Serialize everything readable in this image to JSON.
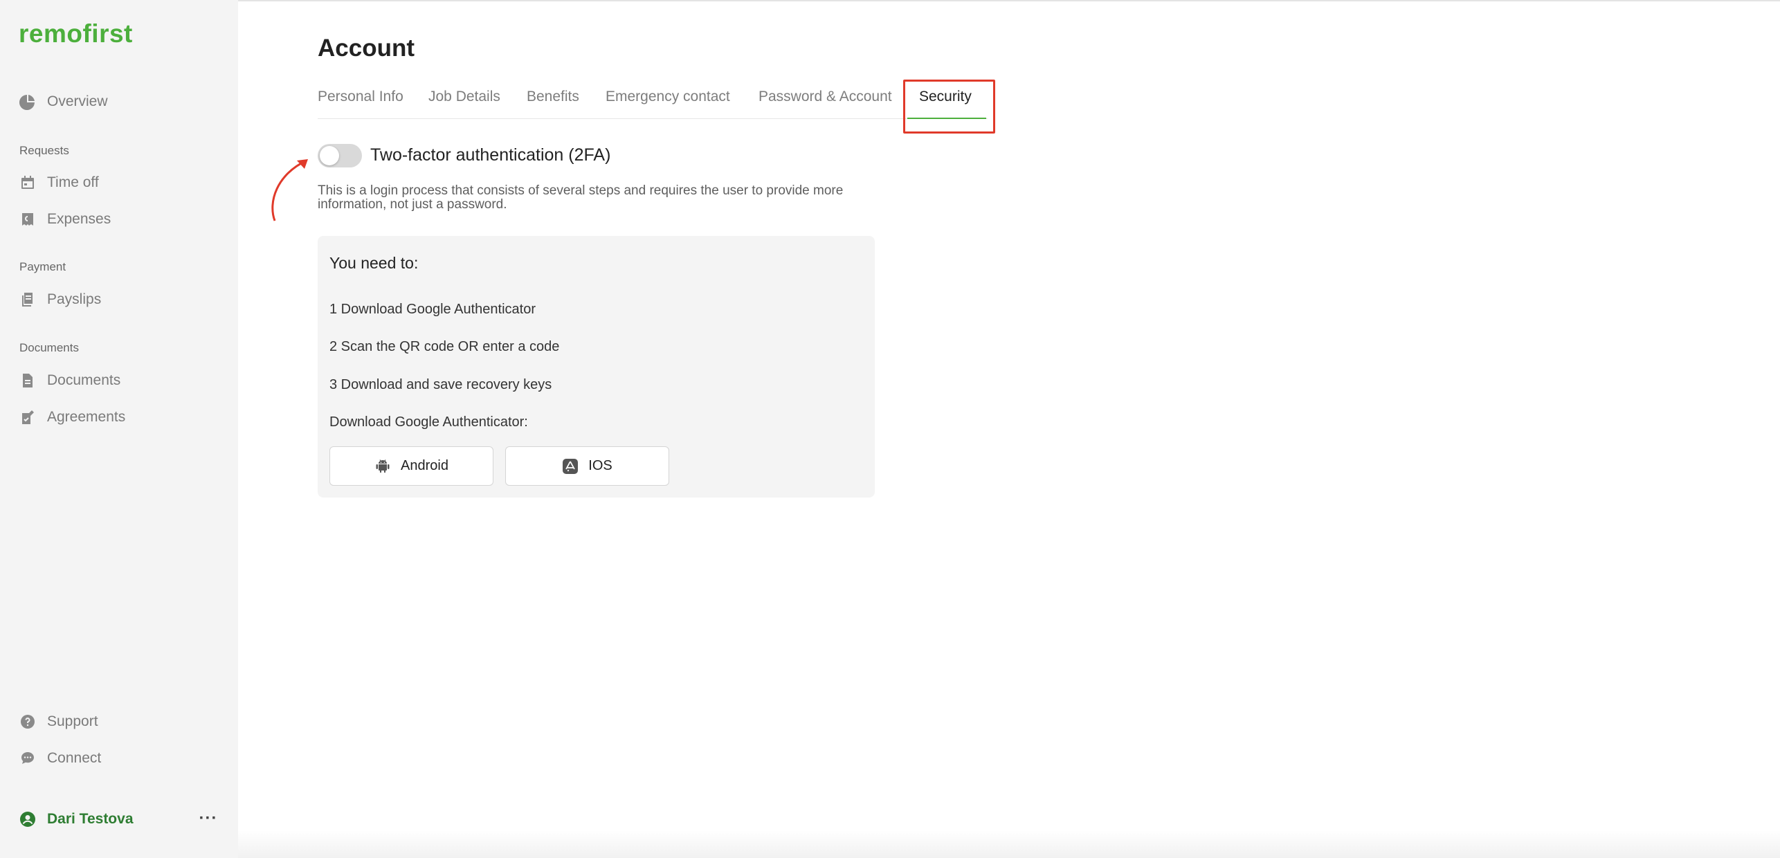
{
  "brand": {
    "logo_text": "remofirst",
    "accent": "#4caf3c"
  },
  "sidebar": {
    "overview": {
      "label": "Overview",
      "icon": "pie-chart-icon"
    },
    "sections": {
      "requests": "Requests",
      "payment": "Payment",
      "documents": "Documents"
    },
    "items": {
      "time_off": {
        "label": "Time off",
        "icon": "calendar-icon"
      },
      "expenses": {
        "label": "Expenses",
        "icon": "receipt-icon"
      },
      "payslips": {
        "label": "Payslips",
        "icon": "payslip-icon"
      },
      "documents": {
        "label": "Documents",
        "icon": "document-icon"
      },
      "agreements": {
        "label": "Agreements",
        "icon": "agreement-icon"
      }
    },
    "support": {
      "label": "Support",
      "icon": "help-icon"
    },
    "connect": {
      "label": "Connect",
      "icon": "chat-icon"
    },
    "user": {
      "name": "Dari Testova",
      "icon": "user-avatar-icon",
      "more": "···"
    }
  },
  "page": {
    "title": "Account",
    "tabs": [
      {
        "label": "Personal Info"
      },
      {
        "label": "Job Details"
      },
      {
        "label": "Benefits"
      },
      {
        "label": "Emergency contact"
      },
      {
        "label": "Password & Account"
      },
      {
        "label": "Security",
        "active": true
      }
    ]
  },
  "security": {
    "toggle_label": "Two-factor authentication (2FA)",
    "toggle_on": false,
    "description": "This is a login process that consists of several steps and requires the user to provide more information, not just a password.",
    "panel": {
      "title": "You need to:",
      "steps": [
        "1 Download Google Authenticator",
        "2 Scan the QR code OR enter a code",
        "3 Download and save recovery keys"
      ],
      "download_label": "Download Google Authenticator:",
      "buttons": [
        {
          "label": "Android",
          "icon": "android-icon"
        },
        {
          "label": "IOS",
          "icon": "app-store-icon"
        }
      ]
    }
  },
  "annotation": {
    "highlight_color": "#e03a2a"
  }
}
